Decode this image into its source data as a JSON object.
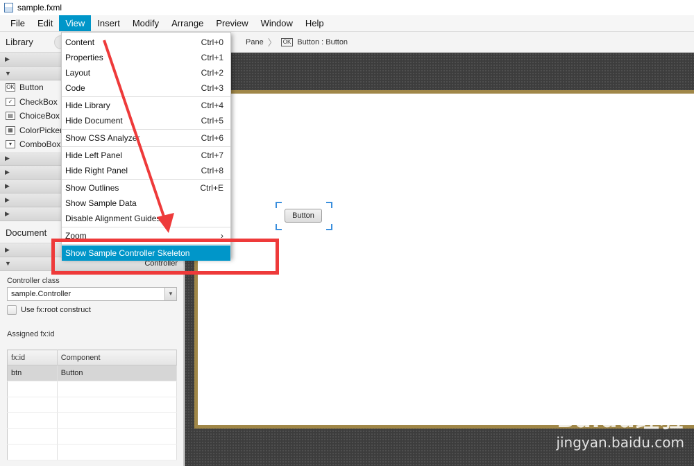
{
  "window": {
    "title": "sample.fxml"
  },
  "menubar": [
    "File",
    "Edit",
    "View",
    "Insert",
    "Modify",
    "Arrange",
    "Preview",
    "Window",
    "Help"
  ],
  "view_menu": [
    {
      "label": "Content",
      "shortcut": "Ctrl+0"
    },
    {
      "label": "Properties",
      "shortcut": "Ctrl+1"
    },
    {
      "label": "Layout",
      "shortcut": "Ctrl+2"
    },
    {
      "label": "Code",
      "shortcut": "Ctrl+3"
    },
    {
      "separator": true
    },
    {
      "label": "Hide Library",
      "shortcut": "Ctrl+4"
    },
    {
      "label": "Hide Document",
      "shortcut": "Ctrl+5"
    },
    {
      "separator": true
    },
    {
      "label": "Show CSS Analyzer",
      "shortcut": "Ctrl+6"
    },
    {
      "separator": true
    },
    {
      "label": "Hide Left Panel",
      "shortcut": "Ctrl+7"
    },
    {
      "label": "Hide Right Panel",
      "shortcut": "Ctrl+8"
    },
    {
      "separator": true
    },
    {
      "label": "Show Outlines",
      "shortcut": "Ctrl+E"
    },
    {
      "label": "Show Sample Data",
      "shortcut": ""
    },
    {
      "label": "Disable Alignment Guides",
      "shortcut": ""
    },
    {
      "separator": true
    },
    {
      "label": "Zoom",
      "shortcut": "›"
    },
    {
      "separator": true
    },
    {
      "label": "Show Sample Controller Skeleton",
      "shortcut": "",
      "highlighted": true
    }
  ],
  "library": {
    "title": "Library",
    "items": [
      {
        "label": "Button",
        "icon": "OK"
      },
      {
        "label": "CheckBox",
        "icon": "✓"
      },
      {
        "label": "ChoiceBox",
        "icon": "▤"
      },
      {
        "label": "ColorPicker",
        "icon": "▦"
      },
      {
        "label": "ComboBox",
        "icon": "▾"
      }
    ]
  },
  "document": {
    "title": "Document",
    "controller_section": "Controller",
    "controller_class_label": "Controller class",
    "controller_class_value": "sample.Controller",
    "fxroot_label": "Use fx:root construct",
    "assigned_label": "Assigned fx:id",
    "columns": [
      "fx:id",
      "Component"
    ],
    "rows": [
      {
        "fxid": "btn",
        "component": "Button"
      }
    ]
  },
  "breadcrumb": {
    "parent": "Pane",
    "current": "Button : Button",
    "current_icon": "OK"
  },
  "canvas": {
    "button_label": "Button"
  },
  "watermark": {
    "logo": "Baidu经验",
    "url": "jingyan.baidu.com"
  },
  "colors": {
    "accent": "#0096c9",
    "annotation": "#ee3a3a",
    "stage_border": "#a08748"
  }
}
